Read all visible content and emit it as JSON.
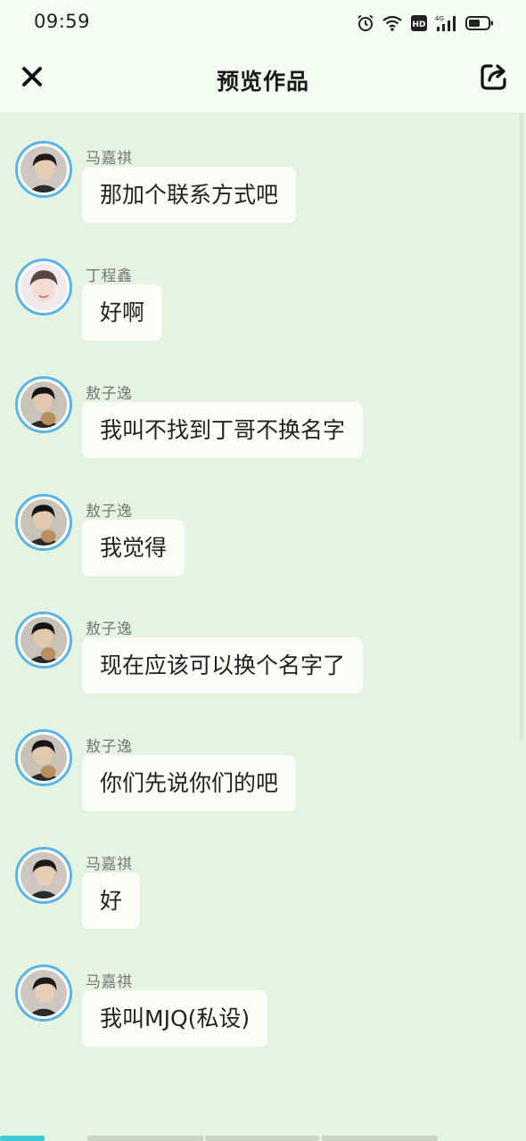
{
  "status_bar": {
    "time": "09:59",
    "icons": [
      "alarm-icon",
      "wifi-icon",
      "hd-icon",
      "signal-4g-icon",
      "battery-icon"
    ],
    "hd_label": "HD",
    "network_label": "4G"
  },
  "header": {
    "title": "预览作品",
    "close_icon": "close-icon",
    "share_icon": "share-icon"
  },
  "colors": {
    "background": "#e5f4e0",
    "header_bg": "#f3fdf1",
    "avatar_ring": "#5ab4e6",
    "bubble_bg": "#fafdf8",
    "active_tab": "#3fcad7"
  },
  "messages": [
    {
      "sender": "马嘉祺",
      "avatar": "avatar-majiaqi",
      "text": "那加个联系方式吧"
    },
    {
      "sender": "丁程鑫",
      "avatar": "avatar-dingchengxin",
      "text": "好啊"
    },
    {
      "sender": "敖子逸",
      "avatar": "avatar-aoziyi",
      "text": "我叫不找到丁哥不换名字"
    },
    {
      "sender": "敖子逸",
      "avatar": "avatar-aoziyi",
      "text": "我觉得"
    },
    {
      "sender": "敖子逸",
      "avatar": "avatar-aoziyi",
      "text": "现在应该可以换个名字了"
    },
    {
      "sender": "敖子逸",
      "avatar": "avatar-aoziyi",
      "text": "你们先说你们的吧"
    },
    {
      "sender": "马嘉祺",
      "avatar": "avatar-majiaqi",
      "text": "好"
    },
    {
      "sender": "马嘉祺",
      "avatar": "avatar-majiaqi",
      "text": "我叫MJQ(私设)"
    }
  ]
}
